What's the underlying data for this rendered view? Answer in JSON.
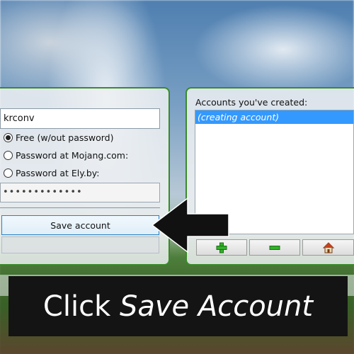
{
  "login_form": {
    "username_value": "krconv",
    "auth_options": [
      {
        "label": "Free (w/out password)",
        "selected": true
      },
      {
        "label": "Password at Mojang.com:",
        "selected": false
      },
      {
        "label": "Password at Ely.by:",
        "selected": false
      }
    ],
    "password_value": "•••••••••••••",
    "save_label": "Save account"
  },
  "accounts": {
    "label": "Accounts you've created:",
    "items": [
      "(creating account)"
    ],
    "buttons": {
      "add_icon": "plus-icon",
      "remove_icon": "minus-icon",
      "home_icon": "house-icon"
    }
  },
  "caption": {
    "prefix": "Click",
    "emphasis": "Save Account"
  },
  "colors": {
    "panel_border": "#3a8a2a",
    "selection": "#3399ff",
    "save_border": "#2a82c4",
    "add_green": "#33b02a",
    "remove_green": "#33b02a",
    "caption_bg": "#141414",
    "arrow": "#111111"
  }
}
